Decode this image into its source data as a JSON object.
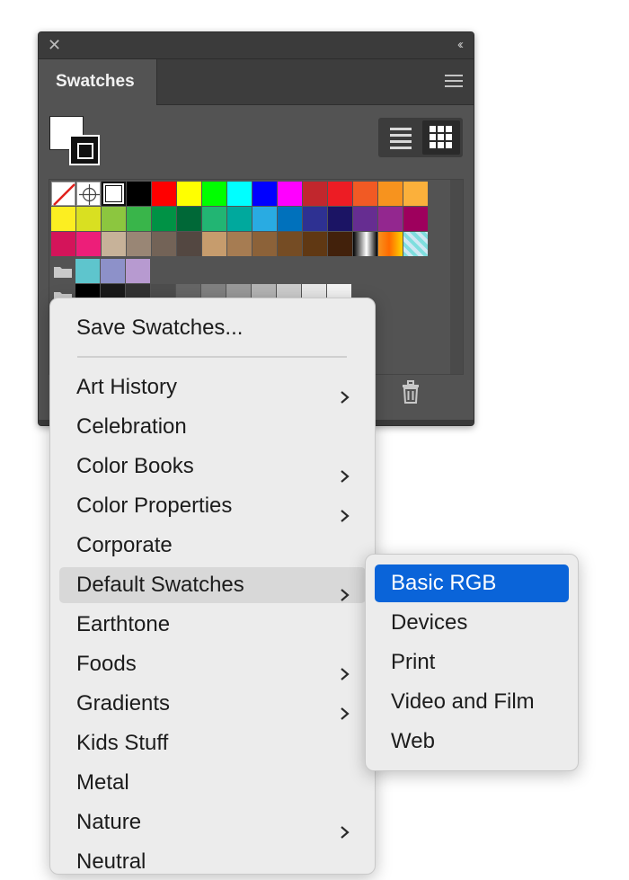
{
  "panel": {
    "tab_label": "Swatches",
    "close_glyph": "✕",
    "collapse_glyph": "‹‹",
    "icons": [
      "close-icon",
      "collapse-icon",
      "panel-menu-icon",
      "list-view-icon",
      "grid-view-icon",
      "folder-icon",
      "trash-icon"
    ]
  },
  "swatches": {
    "row1": [
      "none",
      "registration",
      "white",
      "#000000",
      "#ff0000",
      "#ffff00",
      "#00ff00",
      "#00ffff",
      "#0000ff",
      "#ff00ff",
      "#c1272d",
      "#ed1c24",
      "#f15a24",
      "#f7931e",
      "#fbb03b"
    ],
    "row2": [
      "#fcee21",
      "#d9e021",
      "#8cc63f",
      "#39b54a",
      "#009245",
      "#006837",
      "#22b573",
      "#00a99d",
      "#29abe2",
      "#0071bc",
      "#2e3192",
      "#1b1464",
      "#662d91",
      "#93278f",
      "#9e005d"
    ],
    "row3": [
      "#d4145a",
      "#ed1e79",
      "#c7b299",
      "#998675",
      "#736357",
      "#534741",
      "#c69c6d",
      "#a67c52",
      "#8c6239",
      "#754c24",
      "#603813",
      "#42210b",
      "gradient-bw",
      "gradient-orange",
      "pattern"
    ],
    "group1": [
      "#5ec5cd",
      "#8d91c9",
      "#b79ad0"
    ],
    "group2": [
      "#000000",
      "#1a1a1a",
      "#333333",
      "#4d4d4d",
      "#666666",
      "#808080",
      "#999999",
      "#b3b3b3",
      "#cccccc",
      "#e6e6e6",
      "#f2f2f2"
    ]
  },
  "menu": {
    "save": "Save Swatches...",
    "items": [
      {
        "label": "Art History",
        "submenu": true
      },
      {
        "label": "Celebration",
        "submenu": false
      },
      {
        "label": "Color Books",
        "submenu": true
      },
      {
        "label": "Color Properties",
        "submenu": true
      },
      {
        "label": "Corporate",
        "submenu": false
      },
      {
        "label": "Default Swatches",
        "submenu": true,
        "highlighted": true
      },
      {
        "label": "Earthtone",
        "submenu": false
      },
      {
        "label": "Foods",
        "submenu": true
      },
      {
        "label": "Gradients",
        "submenu": true
      },
      {
        "label": "Kids Stuff",
        "submenu": false
      },
      {
        "label": "Metal",
        "submenu": false
      },
      {
        "label": "Nature",
        "submenu": true
      },
      {
        "label": "Neutral",
        "submenu": false
      }
    ]
  },
  "submenu": {
    "items": [
      "Basic RGB",
      "Devices",
      "Print",
      "Video and Film",
      "Web"
    ],
    "selected": "Basic RGB"
  },
  "colors": {
    "panel_bg": "#535353",
    "menu_bg": "#ececec",
    "selection": "#0a64d9"
  }
}
